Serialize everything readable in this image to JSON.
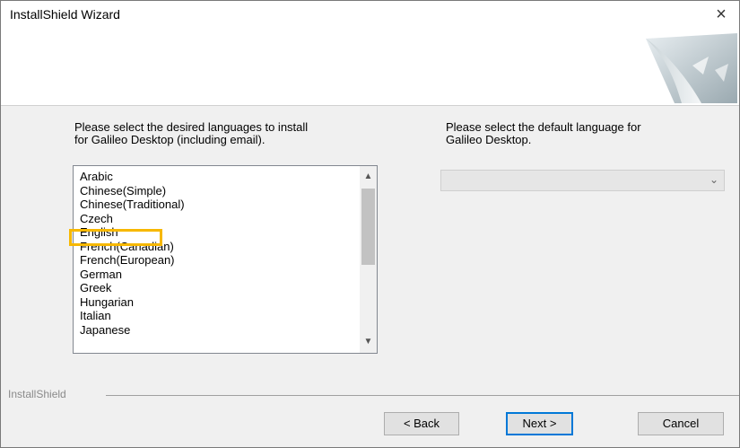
{
  "window": {
    "title": "InstallShield Wizard",
    "close_glyph": "×"
  },
  "left_panel": {
    "instruction_line1": "Please select the desired languages to install",
    "instruction_line2": "for Galileo Desktop (including email).",
    "languages": [
      "Arabic",
      "Chinese(Simple)",
      "Chinese(Traditional)",
      "Czech",
      "English",
      "French(Canadian)",
      "French(European)",
      "German",
      "Greek",
      "Hungarian",
      "Italian",
      "Japanese"
    ],
    "highlighted_item": "English"
  },
  "right_panel": {
    "instruction_line1": "Please select the default language for",
    "instruction_line2": "Galileo Desktop.",
    "combo_value": ""
  },
  "footer": {
    "brand": "InstallShield"
  },
  "buttons": {
    "back": "< Back",
    "next": "Next >",
    "cancel": "Cancel"
  },
  "colors": {
    "highlight_border": "#f7b800",
    "default_button_border": "#0078d7"
  }
}
